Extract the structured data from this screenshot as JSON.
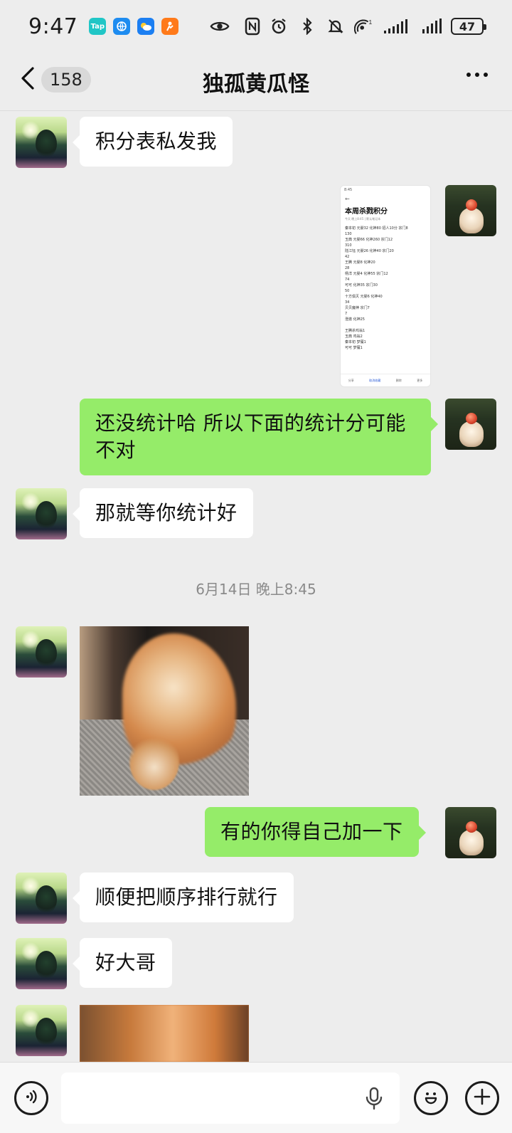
{
  "status_bar": {
    "time": "9:47",
    "app_icons": [
      {
        "name": "taptap-icon",
        "label": "Tap"
      },
      {
        "name": "globe-icon",
        "label": ""
      },
      {
        "name": "weather-icon",
        "label": ""
      },
      {
        "name": "fitness-icon",
        "label": ""
      }
    ],
    "battery": "47",
    "signal_label": "1"
  },
  "header": {
    "back_count": "158",
    "title": "独孤黄瓜怪"
  },
  "messages": [
    {
      "side": "left",
      "text": "积分表私发我"
    },
    {
      "side": "right",
      "type": "screenshot"
    },
    {
      "side": "right",
      "text": "还没统计哈 所以下面的统计分可能不对"
    },
    {
      "side": "left",
      "text": "那就等你统计好"
    },
    {
      "side": "time",
      "text": "6月14日 晚上8:45"
    },
    {
      "side": "left",
      "type": "image"
    },
    {
      "side": "right",
      "text": "有的你得自己加一下"
    },
    {
      "side": "left",
      "text": "顺便把顺序排行就行"
    },
    {
      "side": "left",
      "text": "好大哥"
    },
    {
      "side": "left",
      "type": "image"
    }
  ],
  "screenshot": {
    "status": "8:45",
    "title": "本周杀戮积分",
    "meta": "今天  晚上8:45  |  默认笔记本",
    "lines": [
      "秦本初 元婴32 化神80 招人10分 宗门8",
      "130",
      "玉典 元婴66 化神260 宗门12",
      "310",
      "陆江钰 元婴26 化神40 宗门20",
      "42",
      "王腾 元婴8 化神20",
      "28",
      "杨洋 元婴4 化神55 宗门12",
      "74",
      "可可 化神35 宗门30",
      "50",
      "十方俱灭 元婴6 化神40",
      "34",
      "贝贝魔神 宗门7",
      "7",
      "澄澈 化神25",
      "",
      "王腾杀鸡翁1",
      "玉典 鸡翁2",
      "秦本初 梦魇1",
      "可可 梦魇1"
    ],
    "tabs": [
      "分享",
      "取消收藏",
      "删除",
      "更多"
    ]
  },
  "colors": {
    "background": "#ededed",
    "bubble_mine": "#95ec69",
    "bubble_theirs": "#ffffff",
    "timestamp": "#8a8a8a"
  },
  "icons": {
    "back": "chevron-left-icon",
    "more": "more-dots-icon",
    "voice": "voice-icon",
    "mic": "microphone-icon",
    "emoji": "emoji-icon",
    "plus": "plus-icon"
  }
}
